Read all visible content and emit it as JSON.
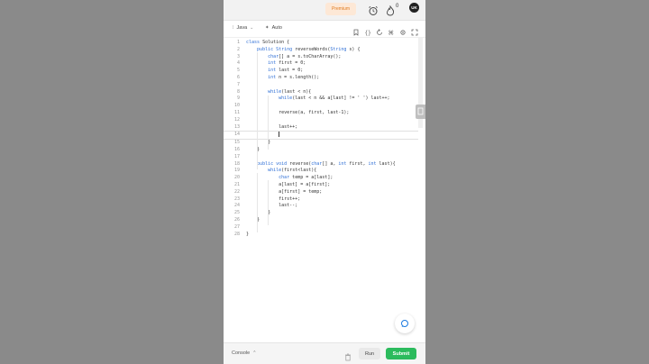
{
  "header": {
    "premium_label": "Premium",
    "flame_count": "0",
    "avatar_initials": "UK"
  },
  "toolbar": {
    "language": "Java",
    "mode": "Auto"
  },
  "code_lines": [
    {
      "n": "1",
      "t": "class Solution {"
    },
    {
      "n": "2",
      "t": "    public String reverseWords(String s) {"
    },
    {
      "n": "3",
      "t": "        char[] a = s.toCharArray();"
    },
    {
      "n": "4",
      "t": "        int first = 0;"
    },
    {
      "n": "5",
      "t": "        int last = 0;"
    },
    {
      "n": "6",
      "t": "        int n = s.length();"
    },
    {
      "n": "7",
      "t": ""
    },
    {
      "n": "8",
      "t": "        while(last < n){"
    },
    {
      "n": "9",
      "t": "            while(last < n && a[last] != ' ') last++;"
    },
    {
      "n": "10",
      "t": ""
    },
    {
      "n": "11",
      "t": "            reverse(a, first, last-1);"
    },
    {
      "n": "12",
      "t": ""
    },
    {
      "n": "13",
      "t": "            last++;"
    },
    {
      "n": "14",
      "t": "            "
    },
    {
      "n": "15",
      "t": "        }"
    },
    {
      "n": "16",
      "t": "    }"
    },
    {
      "n": "17",
      "t": ""
    },
    {
      "n": "18",
      "t": "    public void reverse(char[] a, int first, int last){"
    },
    {
      "n": "19",
      "t": "        while(first<last){"
    },
    {
      "n": "20",
      "t": "            char temp = a[last];"
    },
    {
      "n": "21",
      "t": "            a[last] = a[first];"
    },
    {
      "n": "22",
      "t": "            a[first] = temp;"
    },
    {
      "n": "23",
      "t": "            first++;"
    },
    {
      "n": "24",
      "t": "            last--;"
    },
    {
      "n": "25",
      "t": "        }"
    },
    {
      "n": "26",
      "t": "    }"
    },
    {
      "n": "27",
      "t": ""
    },
    {
      "n": "28",
      "t": "}"
    }
  ],
  "footer": {
    "console_label": "Console",
    "run_label": "Run",
    "submit_label": "Submit"
  },
  "colors": {
    "accent_green": "#2cbb5d",
    "premium_orange": "#e07a1f"
  }
}
